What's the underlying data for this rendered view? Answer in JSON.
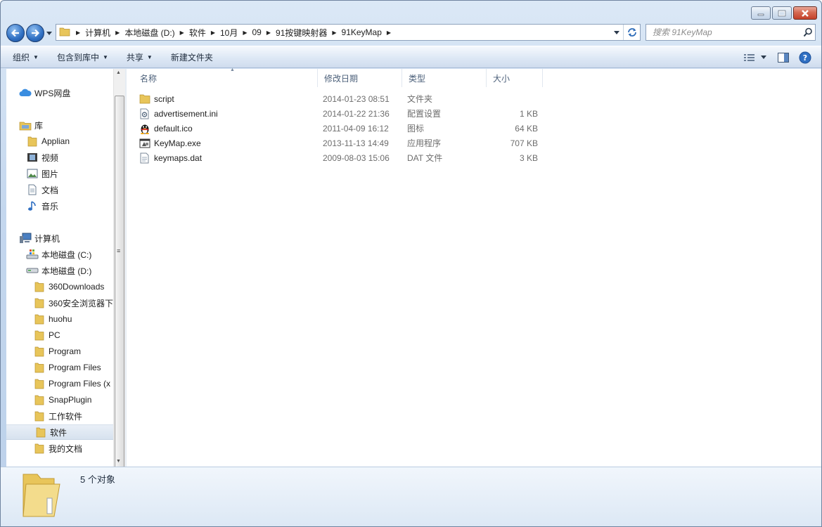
{
  "window": {
    "caption": {
      "minimize": "minimize-icon",
      "maximize": "maximize-icon",
      "close": "close-icon"
    }
  },
  "nav": {
    "back": "back-arrow-icon",
    "forward": "forward-arrow-icon"
  },
  "address": {
    "crumbs": [
      "计算机",
      "本地磁盘 (D:)",
      "软件",
      "10月",
      "09",
      "91按键映射器",
      "91KeyMap"
    ]
  },
  "search": {
    "placeholder": "搜索 91KeyMap"
  },
  "toolbar": {
    "organize": "组织",
    "include_in_library": "包含到库中",
    "share": "共享",
    "new_folder": "新建文件夹"
  },
  "sidebar": {
    "wps": "WPS网盘",
    "library": "库",
    "lib_items": [
      "Applian",
      "视频",
      "图片",
      "文档",
      "音乐"
    ],
    "computer": "计算机",
    "drive_c": "本地磁盘 (C:)",
    "drive_d": "本地磁盘 (D:)",
    "folders": [
      "360Downloads",
      "360安全浏览器下",
      "huohu",
      "PC",
      "Program",
      "Program Files",
      "Program Files (x",
      "SnapPlugin",
      "工作软件",
      "软件",
      "我的文档"
    ],
    "selected_folder": "软件"
  },
  "columns": {
    "name": "名称",
    "modified": "修改日期",
    "type": "类型",
    "size": "大小"
  },
  "files": [
    {
      "name": "script",
      "modified": "2014-01-23 08:51",
      "type": "文件夹",
      "size": "",
      "icon": "folder-icon"
    },
    {
      "name": "advertisement.ini",
      "modified": "2014-01-22 21:36",
      "type": "配置设置",
      "size": "1 KB",
      "icon": "ini-file-icon"
    },
    {
      "name": "default.ico",
      "modified": "2011-04-09 16:12",
      "type": "图标",
      "size": "64 KB",
      "icon": "qq-penguin-icon"
    },
    {
      "name": "KeyMap.exe",
      "modified": "2013-11-13 14:49",
      "type": "应用程序",
      "size": "707 KB",
      "icon": "exe-file-icon"
    },
    {
      "name": "keymaps.dat",
      "modified": "2009-08-03 15:06",
      "type": "DAT 文件",
      "size": "3 KB",
      "icon": "dat-file-icon"
    }
  ],
  "details": {
    "count": "5 个对象"
  },
  "colors": {
    "folder": "#e8c55a",
    "accent": "#2f6fc2",
    "close": "#c4412a"
  }
}
